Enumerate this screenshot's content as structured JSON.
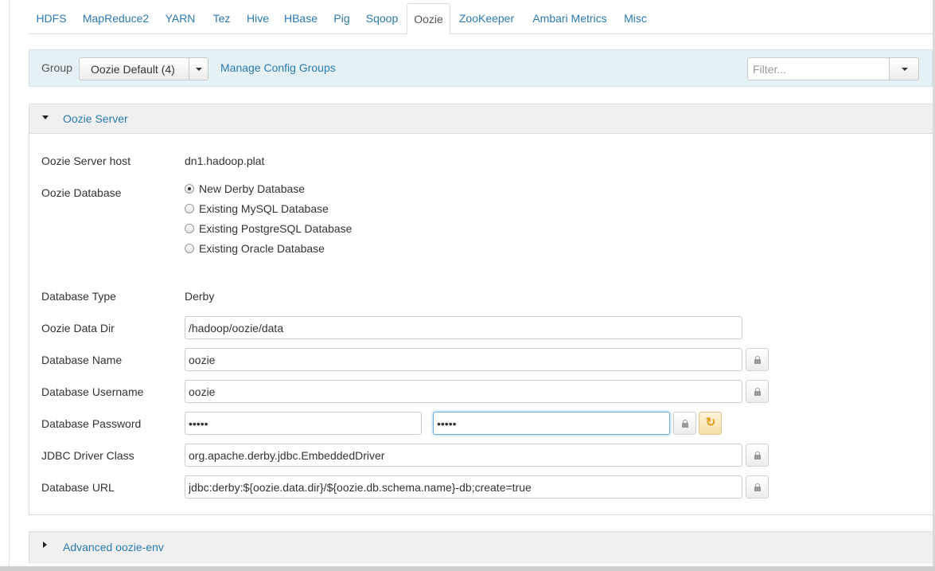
{
  "tabs": [
    {
      "label": "HDFS"
    },
    {
      "label": "MapReduce2"
    },
    {
      "label": "YARN"
    },
    {
      "label": "Tez"
    },
    {
      "label": "Hive"
    },
    {
      "label": "HBase"
    },
    {
      "label": "Pig"
    },
    {
      "label": "Sqoop"
    },
    {
      "label": "Oozie",
      "active": true
    },
    {
      "label": "ZooKeeper"
    },
    {
      "label": "Ambari Metrics"
    },
    {
      "label": "Misc"
    }
  ],
  "toolbar": {
    "group_label": "Group",
    "group_value": "Oozie Default (4)",
    "manage_link": "Manage Config Groups",
    "filter_placeholder": "Filter..."
  },
  "oozie_server": {
    "title": "Oozie Server",
    "host_label": "Oozie Server host",
    "host_value": "dn1.hadoop.plat",
    "database_label": "Oozie Database",
    "database_options": [
      {
        "label": "New Derby Database",
        "checked": true
      },
      {
        "label": "Existing MySQL Database",
        "checked": false
      },
      {
        "label": "Existing PostgreSQL Database",
        "checked": false
      },
      {
        "label": "Existing Oracle Database",
        "checked": false
      }
    ],
    "db_type_label": "Database Type",
    "db_type_value": "Derby",
    "data_dir_label": "Oozie Data Dir",
    "data_dir_value": "/hadoop/oozie/data",
    "db_name_label": "Database Name",
    "db_name_value": "oozie",
    "db_user_label": "Database Username",
    "db_user_value": "oozie",
    "db_password_label": "Database Password",
    "db_password_value": "oozie",
    "db_password_confirm_value": "oozie",
    "jdbc_label": "JDBC Driver Class",
    "jdbc_value": "org.apache.derby.jdbc.EmbeddedDriver",
    "db_url_label": "Database URL",
    "db_url_value": "jdbc:derby:${oozie.data.dir}/${oozie.db.schema.name}-db;create=true"
  },
  "advanced": {
    "title": "Advanced oozie-env"
  },
  "icons": {
    "lock": "lock-icon",
    "undo": "undo-icon",
    "caret": "caret-down-icon"
  },
  "colors": {
    "link": "#2a7ab0",
    "group_bar_bg": "#e6f1f6",
    "undo_accent": "#e29a16"
  }
}
